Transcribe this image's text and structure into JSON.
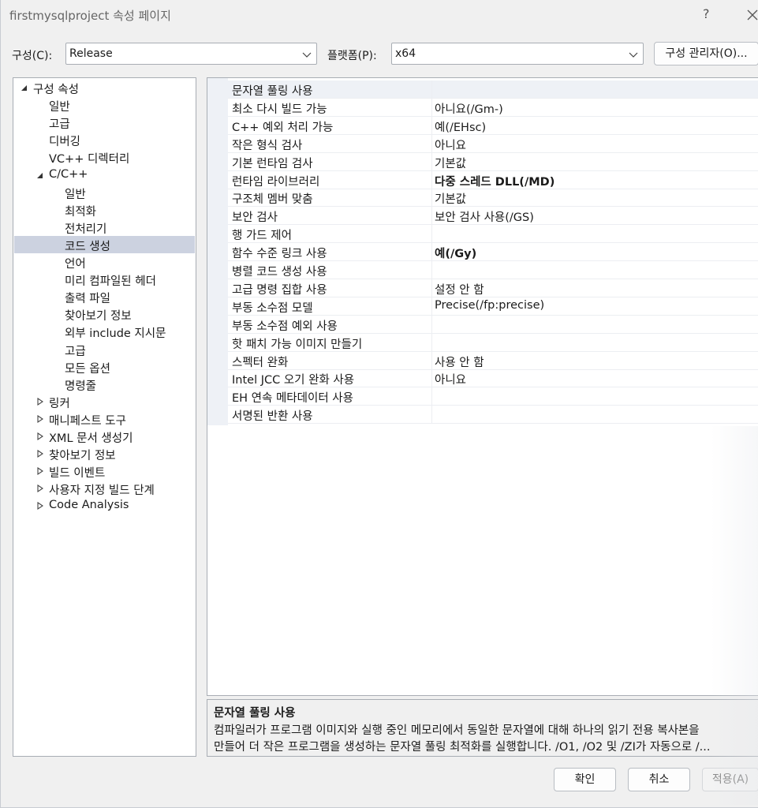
{
  "window": {
    "title": "firstmysqlproject 속성 페이지",
    "help": "?"
  },
  "config": {
    "config_label": "구성(C):",
    "config_value": "Release",
    "platform_label": "플랫폼(P):",
    "platform_value": "x64",
    "manager_button": "구성 관리자(O)..."
  },
  "tree": [
    {
      "label": "구성 속성",
      "level": 0,
      "arrow": "expanded"
    },
    {
      "label": "일반",
      "level": 1,
      "arrow": "none"
    },
    {
      "label": "고급",
      "level": 1,
      "arrow": "none"
    },
    {
      "label": "디버깅",
      "level": 1,
      "arrow": "none"
    },
    {
      "label": "VC++ 디렉터리",
      "level": 1,
      "arrow": "none"
    },
    {
      "label": "C/C++",
      "level": 1,
      "arrow": "expanded"
    },
    {
      "label": "일반",
      "level": 2,
      "arrow": "none"
    },
    {
      "label": "최적화",
      "level": 2,
      "arrow": "none"
    },
    {
      "label": "전처리기",
      "level": 2,
      "arrow": "none"
    },
    {
      "label": "코드 생성",
      "level": 2,
      "arrow": "none",
      "selected": true
    },
    {
      "label": "언어",
      "level": 2,
      "arrow": "none"
    },
    {
      "label": "미리 컴파일된 헤더",
      "level": 2,
      "arrow": "none"
    },
    {
      "label": "출력 파일",
      "level": 2,
      "arrow": "none"
    },
    {
      "label": "찾아보기 정보",
      "level": 2,
      "arrow": "none"
    },
    {
      "label": "외부 include 지시문",
      "level": 2,
      "arrow": "none"
    },
    {
      "label": "고급",
      "level": 2,
      "arrow": "none"
    },
    {
      "label": "모든 옵션",
      "level": 2,
      "arrow": "none"
    },
    {
      "label": "명령줄",
      "level": 2,
      "arrow": "none"
    },
    {
      "label": "링커",
      "level": 1,
      "arrow": "collapsed"
    },
    {
      "label": "매니페스트 도구",
      "level": 1,
      "arrow": "collapsed"
    },
    {
      "label": "XML 문서 생성기",
      "level": 1,
      "arrow": "collapsed"
    },
    {
      "label": "찾아보기 정보",
      "level": 1,
      "arrow": "collapsed"
    },
    {
      "label": "빌드 이벤트",
      "level": 1,
      "arrow": "collapsed"
    },
    {
      "label": "사용자 지정 빌드 단계",
      "level": 1,
      "arrow": "collapsed"
    },
    {
      "label": "Code Analysis",
      "level": 1,
      "arrow": "collapsed"
    }
  ],
  "properties": [
    {
      "name": "문자열 풀링 사용",
      "value": "",
      "bold": false,
      "header": true
    },
    {
      "name": "최소 다시 빌드 가능",
      "value": "아니요(/Gm-)",
      "bold": false
    },
    {
      "name": "C++ 예외 처리 가능",
      "value": "예(/EHsc)",
      "bold": false
    },
    {
      "name": "작은 형식 검사",
      "value": "아니요",
      "bold": false
    },
    {
      "name": "기본 런타임 검사",
      "value": "기본값",
      "bold": false
    },
    {
      "name": "런타임 라이브러리",
      "value": "다중 스레드 DLL(/MD)",
      "bold": true
    },
    {
      "name": "구조체 멤버 맞춤",
      "value": "기본값",
      "bold": false
    },
    {
      "name": "보안 검사",
      "value": "보안 검사 사용(/GS)",
      "bold": false
    },
    {
      "name": "행 가드 제어",
      "value": "",
      "bold": false
    },
    {
      "name": "함수 수준 링크 사용",
      "value": "예(/Gy)",
      "bold": true
    },
    {
      "name": "병렬 코드 생성 사용",
      "value": "",
      "bold": false
    },
    {
      "name": "고급 명령 집합 사용",
      "value": "설정 안 함",
      "bold": false
    },
    {
      "name": "부동 소수점 모델",
      "value": "Precise(/fp:precise)",
      "bold": false
    },
    {
      "name": "부동 소수점 예외 사용",
      "value": "",
      "bold": false
    },
    {
      "name": "핫 패치 가능 이미지 만들기",
      "value": "",
      "bold": false
    },
    {
      "name": "스펙터 완화",
      "value": "사용 안 함",
      "bold": false
    },
    {
      "name": "Intel JCC 오기 완화 사용",
      "value": "아니요",
      "bold": false
    },
    {
      "name": "EH 연속 메타데이터 사용",
      "value": "",
      "bold": false
    },
    {
      "name": "서명된 반환 사용",
      "value": "",
      "bold": false
    }
  ],
  "description": {
    "title": "문자열 풀링 사용",
    "line1": "컴파일러가 프로그램 이미지와 실행 중인 메모리에서 동일한 문자열에 대해 하나의 읽기 전용 복사본을",
    "line2": "만들어 더 작은 프로그램을 생성하는 문자열 풀링 최적화를 실행합니다. /O1, /O2 및 /ZI가 자동으로 /..."
  },
  "buttons": {
    "ok": "확인",
    "cancel": "취소",
    "apply": "적용(A)"
  }
}
